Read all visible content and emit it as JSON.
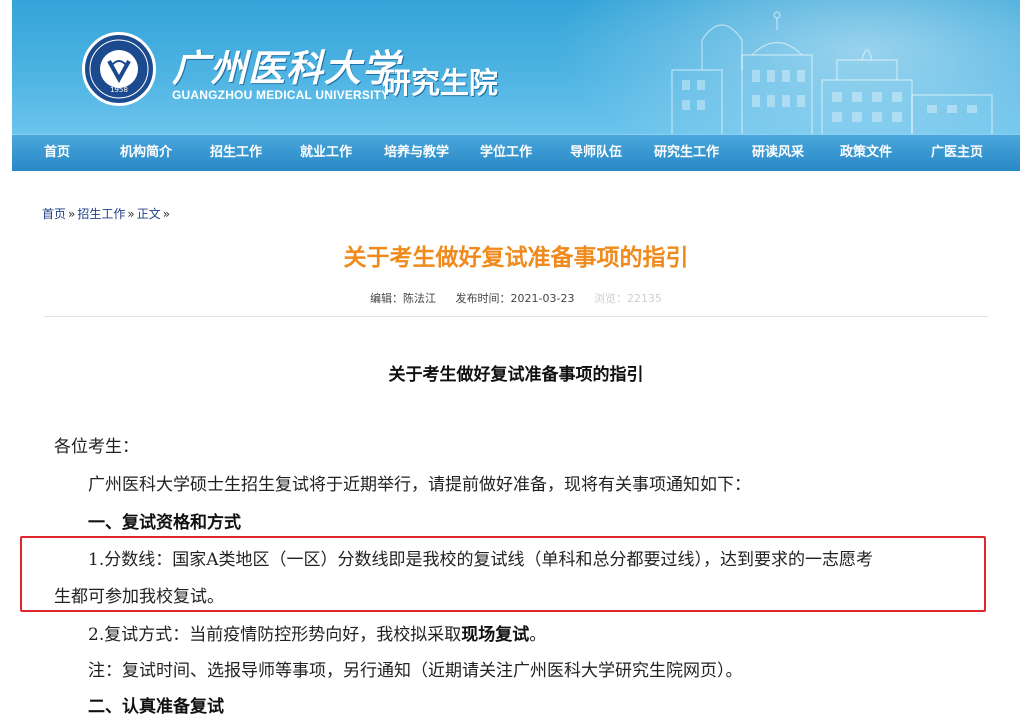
{
  "header": {
    "logo_year": "1958",
    "university_cn": "广州医科大学",
    "university_en": "GUANGZHOU MEDICAL UNIVERSITY",
    "school": "研究生院"
  },
  "nav": [
    "首页",
    "机构简介",
    "招生工作",
    "就业工作",
    "培养与教学",
    "学位工作",
    "导师队伍",
    "研究生工作",
    "研读风采",
    "政策文件",
    "广医主页"
  ],
  "breadcrumb": [
    "首页",
    "招生工作",
    "正文"
  ],
  "breadcrumb_sep": "»",
  "article": {
    "title": "关于考生做好复试准备事项的指引",
    "editor": "编辑：陈法江",
    "published": "发布时间：2021-03-23",
    "views": "浏览：22135",
    "doc_title": "关于考生做好复试准备事项的指引",
    "greeting": "各位考生：",
    "intro": "广州医科大学硕士生招生复试将于近期举行，请提前做好准备，现将有关事项通知如下：",
    "section1": "一、复试资格和方式",
    "item1_line1": "1.分数线：国家A类地区（一区）分数线即是我校的复试线（单科和总分都要过线），达到要求的一志愿考",
    "item1_line2": "生都可参加我校复试。",
    "item2_prefix": "2.复试方式：当前疫情防控形势向好，我校拟采取",
    "item2_bold": "现场复试",
    "item2_suffix": "。",
    "note": "注：复试时间、选报导师等事项，另行通知（近期请关注广州医科大学研究生院网页）。",
    "section2": "二、认真准备复试"
  },
  "colors": {
    "banner": "#4db3e2",
    "nav": "#2888c6",
    "title": "#f08a1c",
    "highlight_border": "#e0262d",
    "link": "#1f3f8a"
  }
}
